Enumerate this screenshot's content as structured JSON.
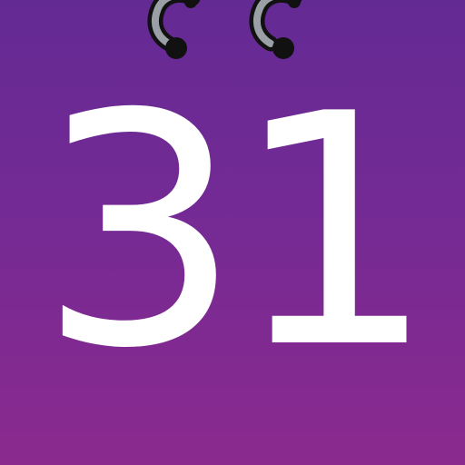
{
  "calendar_icon": {
    "day": "31",
    "background_top": "#642a94",
    "background_bottom": "#8a2a8e",
    "ring_icon": "binder-ring-icon",
    "ring_color": "#111111",
    "day_color": "#ffffff"
  }
}
